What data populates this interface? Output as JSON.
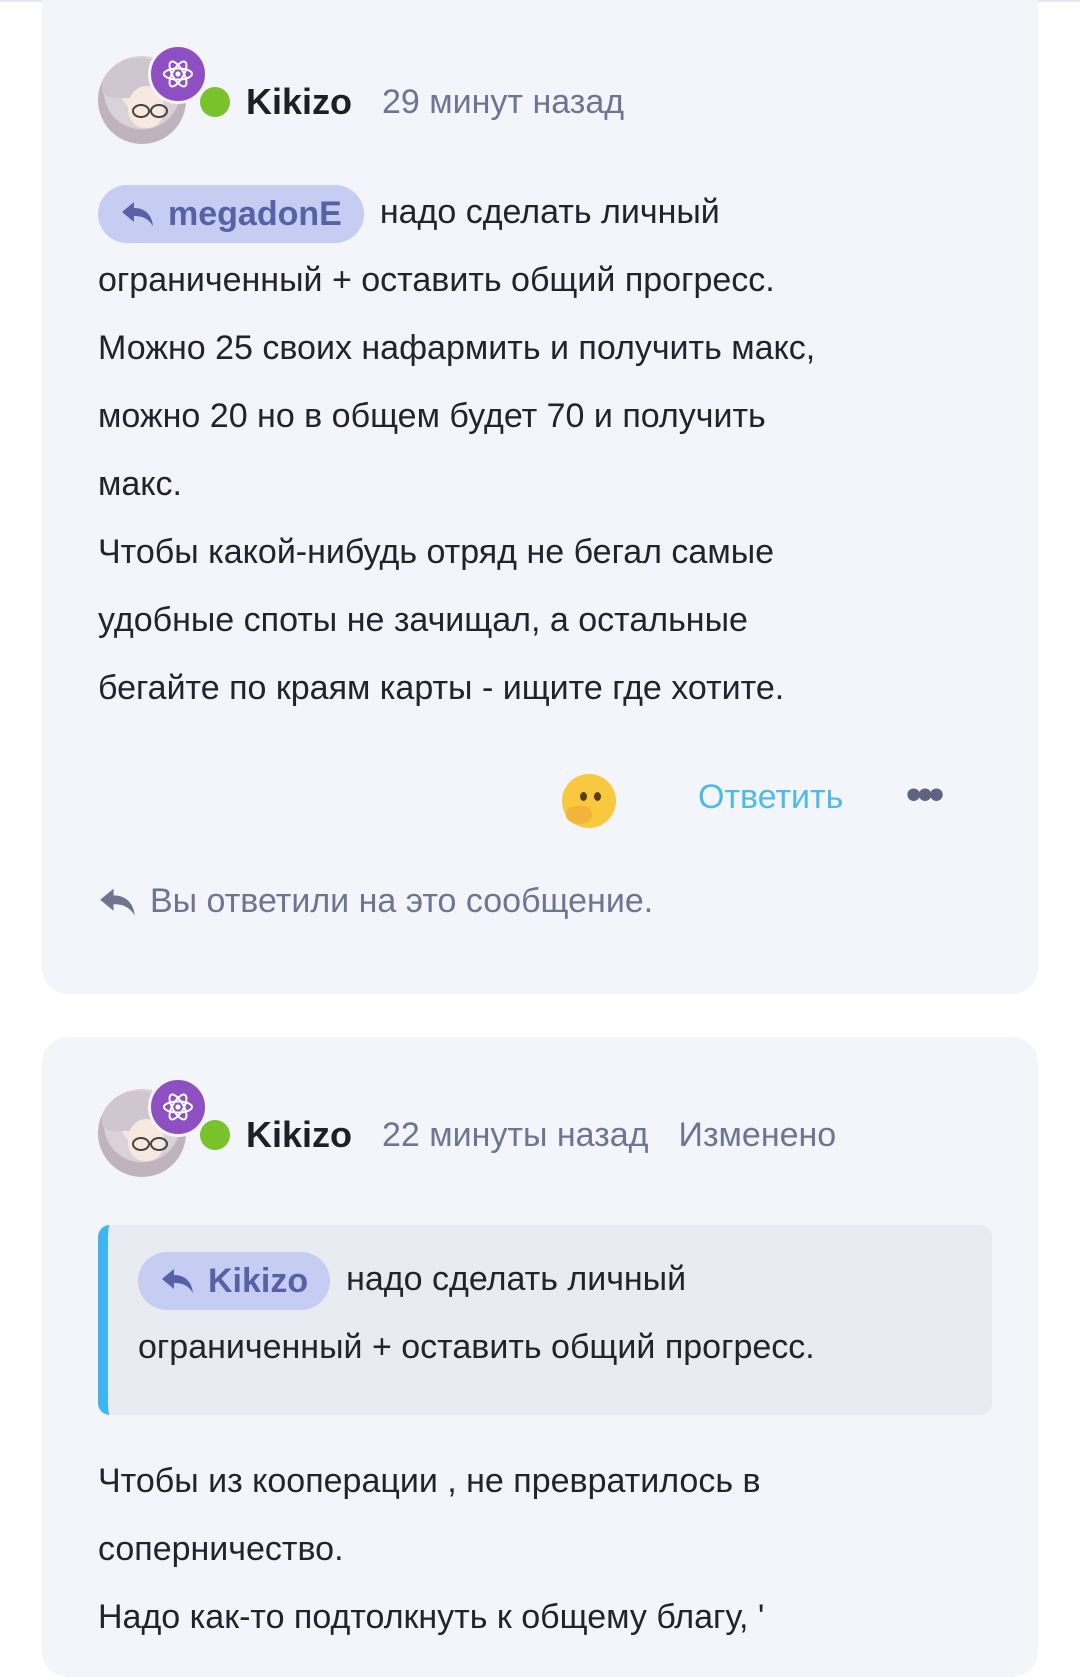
{
  "post1": {
    "author": "Kikizo",
    "time": "29 минут назад",
    "mention": "megadonE",
    "lines": [
      "надо сделать личный",
      "ограниченный + оставить общий прогресс.",
      "Можно 25 своих нафармить и получить макс,",
      "можно 20 но в общем будет 70 и получить",
      "макс.",
      "Чтобы какой-нибудь отряд не бегал самые",
      "удобные споты не зачищал, а остальные",
      "бегайте по краям карты - ищите где хотите."
    ],
    "reply_label": "Ответить",
    "more_label": "•••",
    "replied_notice": "Вы ответили на это сообщение."
  },
  "post2": {
    "author": "Kikizo",
    "time": "22 минуты назад",
    "edited": "Изменено",
    "quote_mention": "Kikizo",
    "quote_lines": [
      "надо сделать личный",
      "ограниченный + оставить общий прогресс."
    ],
    "lines": [
      "Чтобы из кооперации , не превратилось в",
      "соперничество.",
      "Надо как-то подтолкнуть к общему благу, '"
    ]
  }
}
